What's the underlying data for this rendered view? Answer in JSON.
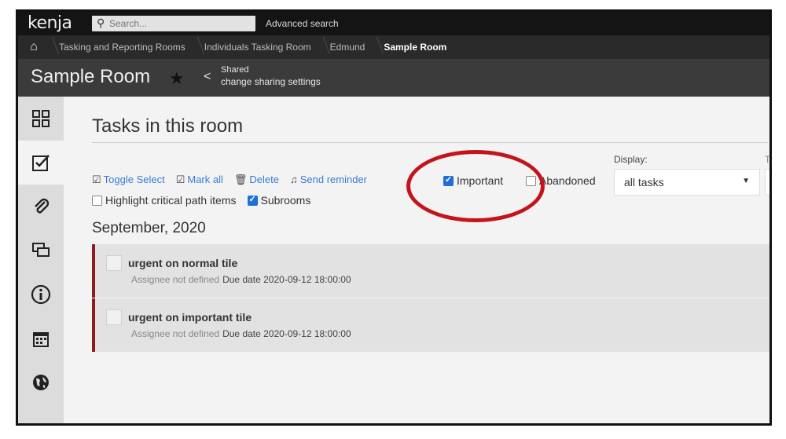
{
  "app": {
    "logo": "kenja"
  },
  "search": {
    "placeholder": "Search...",
    "advanced": "Advanced search"
  },
  "breadcrumb": [
    "Tasking and Reporting Rooms",
    "Individuals Tasking Room",
    "Edmund",
    "Sample Room"
  ],
  "room": {
    "title": "Sample Room",
    "shared": "Shared",
    "sharing_link": "change sharing settings"
  },
  "sidebar": {
    "items": [
      "dashboard",
      "tasks",
      "attachments",
      "chat",
      "info",
      "calendar",
      "globe"
    ]
  },
  "main": {
    "title": "Tasks in this room",
    "toolbar": [
      "Toggle Select",
      "Mark all",
      "Delete",
      "Send reminder"
    ],
    "filters": {
      "important_label": "Important",
      "important_checked": true,
      "abandoned_label": "Abandoned",
      "abandoned_checked": false
    },
    "display": {
      "label": "Display:",
      "value": "all tasks",
      "second_label": "T"
    },
    "options": {
      "highlight_label": "Highlight critical path items",
      "highlight_checked": false,
      "subrooms_label": "Subrooms",
      "subrooms_checked": true
    },
    "month": "September, 2020",
    "tasks": [
      {
        "name": "urgent on normal tile",
        "assignee": "Assignee not defined",
        "due": "Due date 2020-09-12 18:00:00"
      },
      {
        "name": "urgent on important tile",
        "assignee": "Assignee not defined",
        "due": "Due date 2020-09-12 18:00:00"
      }
    ]
  },
  "annotation": {
    "color": "#c4141b"
  },
  "colors": {
    "accent": "#3a7bd5",
    "task_border": "#8e1b1f"
  }
}
